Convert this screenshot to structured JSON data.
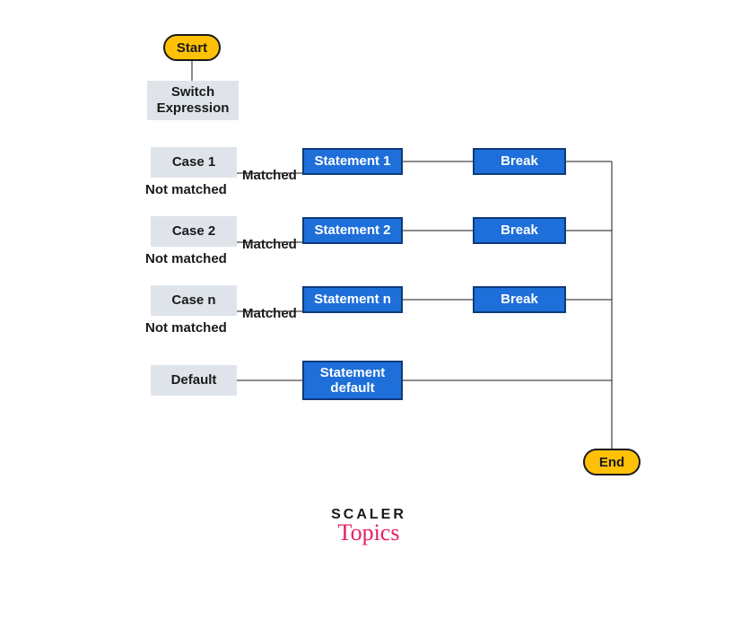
{
  "start": {
    "label": "Start"
  },
  "switch_expression": {
    "label": "Switch\nExpression"
  },
  "cases": [
    {
      "name": "Case 1",
      "matched": "Matched",
      "not_matched": "Not matched",
      "statement": "Statement 1",
      "break": "Break"
    },
    {
      "name": "Case 2",
      "matched": "Matched",
      "not_matched": "Not matched",
      "statement": "Statement 2",
      "break": "Break"
    },
    {
      "name": "Case n",
      "matched": "Matched",
      "not_matched": "Not matched",
      "statement": "Statement n",
      "break": "Break"
    }
  ],
  "default_case": {
    "name": "Default",
    "statement": "Statement\ndefault"
  },
  "end": {
    "label": "End"
  },
  "logo": {
    "top": "SCALER",
    "bottom": "Topics"
  },
  "colors": {
    "pill_bg": "#ffc107",
    "gray_bg": "#dfe4ea",
    "blue_bg": "#1e6fd9",
    "blue_border": "#0d3a7a",
    "text": "#1a1a1a",
    "logo_accent": "#e91e63"
  },
  "diagram_type": "flowchart",
  "description": "Switch-case control flow diagram"
}
